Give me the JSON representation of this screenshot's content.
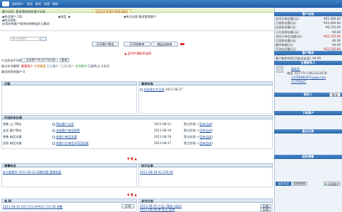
{
  "topbar": {
    "user": "当前用户:",
    "items": [
      "首页",
      "收件",
      "消息",
      "帮助"
    ]
  },
  "banner": {
    "greeting": "客户成员: 是多营销排名客户分析",
    "tag": "【业务开发客户排序调查】",
    "lines": [
      [
        "◆热点客户 1家",
        "◆热度: ◆",
        "◆热点仪表 跟进管理客户"
      ],
      [
        "◆热点组织"
      ],
      [
        "应用仅有客户相关的销售组织之事项"
      ]
    ],
    "buttons": [
      "打印客户报告",
      "打印销售单",
      "输出出纳单"
    ],
    "search_placeholder": "输入关键字",
    "notice": "▲ 此列中请联系选择",
    "filter_label": "产品状态平均数:",
    "filter_value": "---全部客户状况平均内容---",
    "filter_go": "查询",
    "legend_label": "图示符号解释:",
    "legend_items": [
      "重要客户",
      "近期重要",
      "已订客户",
      "已消失客户",
      "合同期内",
      "已联系过",
      "未联系"
    ],
    "current_label": "最近联系的客户 0"
  },
  "schedule": {
    "title": "日程",
    "task_title": "商务任务",
    "task_row": {
      "text": "未安排工作日程",
      "date": "2011-08-27"
    }
  },
  "activities": {
    "title": "行动历史记录",
    "rows": [
      {
        "type": "销售 上门拜访",
        "content": "拜访客户记录",
        "date": "2011-08-21",
        "stage": "第三阶段一(",
        "status": "没有达成",
        "end": ")"
      },
      {
        "type": "业务 客户拜访",
        "content": "未按客户电话再拜",
        "date": "2011-08-19",
        "stage": "第三阶段一(",
        "status": "没有达成",
        "end": ")"
      },
      {
        "type": "销售 电话沟通",
        "content": "给客户电话沟通",
        "date": "2011-08-19",
        "stage": "第三阶段一(",
        "status": "没有达成",
        "end": ")"
      },
      {
        "type": "回程 电话沟通",
        "content": "给客户打电话对项目回复",
        "date": "2011-08-17",
        "stage": "第三阶段一(",
        "status": "没有达成",
        "end": ")"
      }
    ]
  },
  "divider1": "▼ 收 ▲",
  "sales": {
    "chance_title": "销售机会",
    "chance_row": "办公楼楼宇 2011-08-12 初期问题 意愿程度",
    "contract_title": "执行记录",
    "contract_row": "2011-08-18 ¥2,720.00"
  },
  "divider2": "▼ 收 ▲",
  "bottom": {
    "left_title": "合 同",
    "left_row": "2011-08-20 ¥22,725.00/¥22,725.00 销售",
    "left_tag": "记录",
    "right_title": "支付计划",
    "right_rows": [
      "2011-08-20 产品 / 服务 (成员)",
      "2011-08-08 单 标记 结束"
    ],
    "right_tags": [
      "记录",
      "记录"
    ]
  },
  "sidebar": {
    "summary_title": "客户总结",
    "summary_rows": [
      [
        "合同订单总额(元):",
        "¥65,400.00"
      ],
      [
        "已收款总额(元):",
        "¥43,400.00"
      ],
      [
        "应收款总额(元):",
        "¥6,725.00"
      ],
      [
        "已开发票总额(元):",
        "¥0.00"
      ],
      [
        "合同订单总金额(元):",
        "¥22,725.00"
      ],
      [
        "已回款总额(元):",
        "¥0.00"
      ],
      [
        "剩余单据(元):",
        "¥0.00"
      ],
      [
        "不达标总额(元):",
        "¥22,725.00"
      ],
      [
        "欠款(元):",
        "¥0.00"
      ]
    ],
    "summary_more": "更多",
    "pending_title": "客户剩余",
    "pending_row_label": "客户剩余时间(可能会延误):",
    "pending_row_value": "¥0.00",
    "contact_title": "主要联系人",
    "contact_name": "梁先生",
    "contact_phone": "电话: 83777t 15922223578",
    "contact_email": "13758082871@qq.com",
    "contact_qq": "11750637",
    "relation_title": "联系人",
    "relation_more": "更多",
    "next_title": "下级客户",
    "memo_title": "备忘记录",
    "opp_title": "相关销售",
    "tab_active": "业务机会",
    "tab_other": "相关报表",
    "add_label": "添加客户"
  }
}
